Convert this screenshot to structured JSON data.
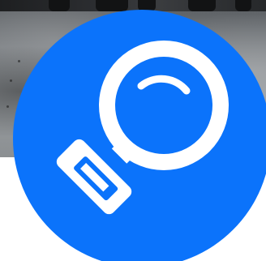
{
  "profile": {
    "badge_color": "#0b73fb",
    "icon": "magnifying-glass-icon",
    "icon_color": "#ffffff"
  },
  "cover": {
    "description_tone": "grey"
  }
}
